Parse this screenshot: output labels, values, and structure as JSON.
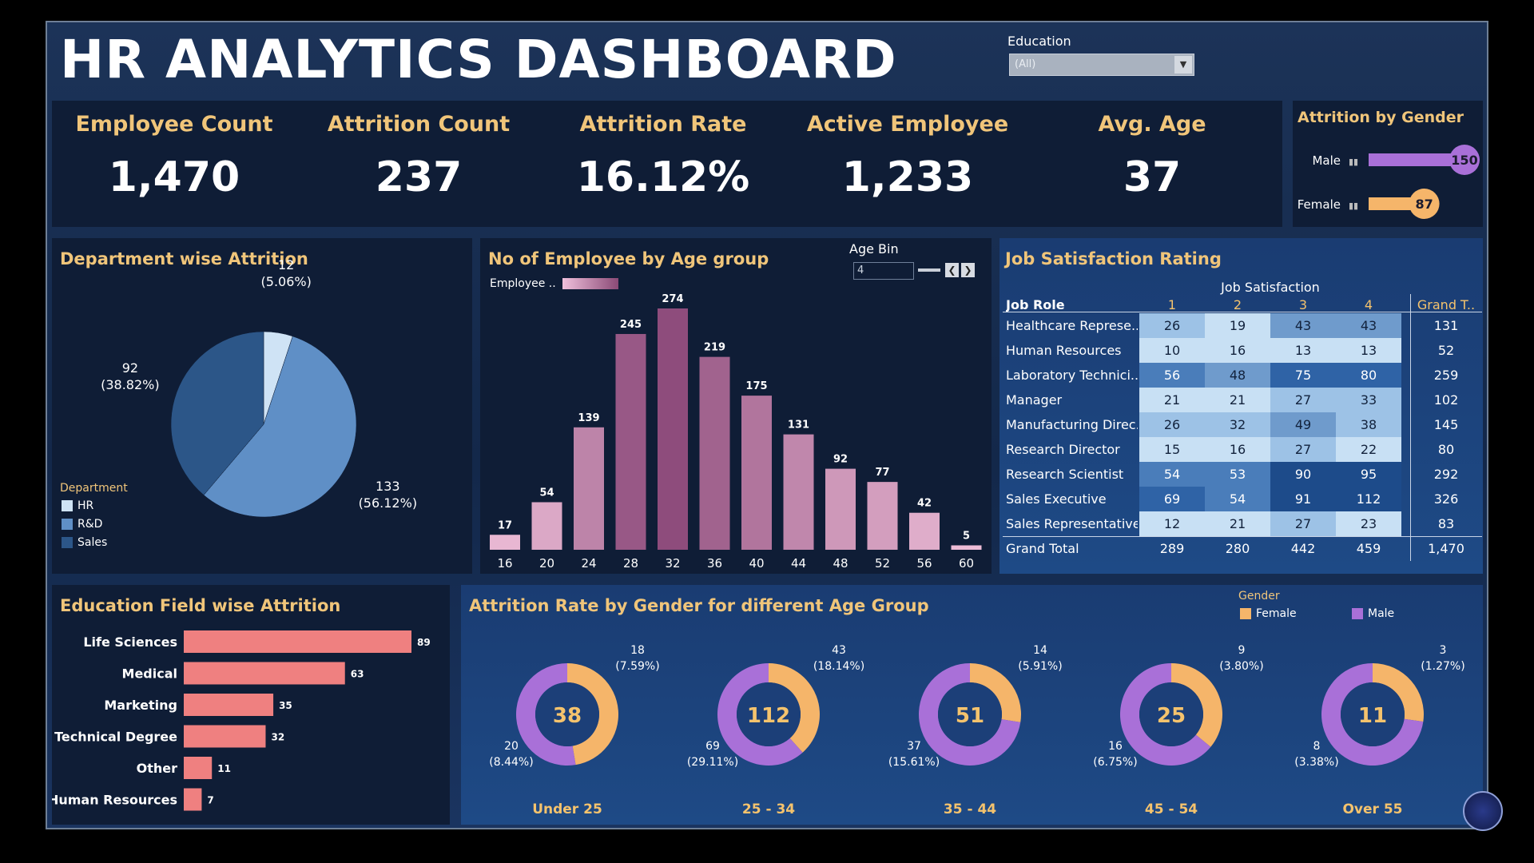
{
  "title": "HR ANALYTICS DASHBOARD",
  "filter": {
    "label": "Education",
    "value": "(All)"
  },
  "kpis": [
    {
      "label": "Employee Count",
      "value": "1,470"
    },
    {
      "label": "Attrition Count",
      "value": "237"
    },
    {
      "label": "Attrition Rate",
      "value": "16.12%"
    },
    {
      "label": "Active Employee",
      "value": "1,233"
    },
    {
      "label": "Avg. Age",
      "value": "37"
    }
  ],
  "gender": {
    "title": "Attrition by Gender",
    "rows": [
      {
        "label": "Male",
        "value": 150,
        "text": "150",
        "color": "#a970d8"
      },
      {
        "label": "Female",
        "value": 87,
        "text": "87",
        "color": "#f5b56a"
      }
    ]
  },
  "dept": {
    "title": "Department wise Attrition",
    "legend_title": "Department",
    "slices": [
      {
        "name": "HR",
        "value": 12,
        "label1": "12",
        "label2": "(5.06%)",
        "color": "#cfe3f5"
      },
      {
        "name": "R&D",
        "value": 133,
        "label1": "133",
        "label2": "(56.12%)",
        "color": "#5f8fc6"
      },
      {
        "name": "Sales",
        "value": 92,
        "label1": "92",
        "label2": "(38.82%)",
        "color": "#2c5688"
      }
    ]
  },
  "age": {
    "title": "No of Employee by Age group",
    "legend_label": "Employee ..",
    "bin_label": "Age Bin",
    "bin_value": "4",
    "bars": [
      {
        "x": "16",
        "v": 17
      },
      {
        "x": "20",
        "v": 54
      },
      {
        "x": "24",
        "v": 139
      },
      {
        "x": "28",
        "v": 245
      },
      {
        "x": "32",
        "v": 274
      },
      {
        "x": "36",
        "v": 219
      },
      {
        "x": "40",
        "v": 175
      },
      {
        "x": "44",
        "v": 131
      },
      {
        "x": "48",
        "v": 92
      },
      {
        "x": "52",
        "v": 77
      },
      {
        "x": "56",
        "v": 42
      },
      {
        "x": "60",
        "v": 5
      }
    ]
  },
  "jobsat": {
    "title": "Job Satisfaction Rating",
    "col_group": "Job Satisfaction",
    "row_header": "Job Role",
    "cols": [
      "1",
      "2",
      "3",
      "4"
    ],
    "grand_header": "Grand T..",
    "rows": [
      {
        "role": "Healthcare Represe..",
        "vals": [
          26,
          19,
          43,
          43
        ],
        "total": "131"
      },
      {
        "role": "Human Resources",
        "vals": [
          10,
          16,
          13,
          13
        ],
        "total": "52"
      },
      {
        "role": "Laboratory Technici..",
        "vals": [
          56,
          48,
          75,
          80
        ],
        "total": "259"
      },
      {
        "role": "Manager",
        "vals": [
          21,
          21,
          27,
          33
        ],
        "total": "102"
      },
      {
        "role": "Manufacturing Direc..",
        "vals": [
          26,
          32,
          49,
          38
        ],
        "total": "145"
      },
      {
        "role": "Research Director",
        "vals": [
          15,
          16,
          27,
          22
        ],
        "total": "80"
      },
      {
        "role": "Research Scientist",
        "vals": [
          54,
          53,
          90,
          95
        ],
        "total": "292"
      },
      {
        "role": "Sales Executive",
        "vals": [
          69,
          54,
          91,
          112
        ],
        "total": "326"
      },
      {
        "role": "Sales Representative",
        "vals": [
          12,
          21,
          27,
          23
        ],
        "total": "83"
      }
    ],
    "grand_label": "Grand Total",
    "grand_vals": [
      "289",
      "280",
      "442",
      "459"
    ],
    "grand_total": "1,470"
  },
  "edu": {
    "title": "Education Field wise Attrition",
    "bars": [
      {
        "name": "Life Sciences",
        "v": 89
      },
      {
        "name": "Medical",
        "v": 63
      },
      {
        "name": "Marketing",
        "v": 35
      },
      {
        "name": "Technical Degree",
        "v": 32
      },
      {
        "name": "Other",
        "v": 11
      },
      {
        "name": "Human Resources",
        "v": 7
      }
    ],
    "color": "#ef8080"
  },
  "donuts": {
    "title": "Attrition Rate by Gender for different Age Group",
    "legend_title": "Gender",
    "legend": [
      {
        "name": "Female",
        "color": "#f5b56a"
      },
      {
        "name": "Male",
        "color": "#a970d8"
      }
    ],
    "groups": [
      {
        "label": "Under 25",
        "total": "38",
        "female": 18,
        "male": 20,
        "f1": "18",
        "f2": "(7.59%)",
        "m1": "20",
        "m2": "(8.44%)"
      },
      {
        "label": "25 - 34",
        "total": "112",
        "female": 43,
        "male": 69,
        "f1": "43",
        "f2": "(18.14%)",
        "m1": "69",
        "m2": "(29.11%)"
      },
      {
        "label": "35 - 44",
        "total": "51",
        "female": 14,
        "male": 37,
        "f1": "14",
        "f2": "(5.91%)",
        "m1": "37",
        "m2": "(15.61%)"
      },
      {
        "label": "45 - 54",
        "total": "25",
        "female": 9,
        "male": 16,
        "f1": "9",
        "f2": "(3.80%)",
        "m1": "16",
        "m2": "(6.75%)"
      },
      {
        "label": "Over 55",
        "total": "11",
        "female": 3,
        "male": 8,
        "f1": "3",
        "f2": "(1.27%)",
        "m1": "8",
        "m2": "(3.38%)"
      }
    ]
  },
  "chart_data": [
    {
      "type": "bar",
      "title": "Attrition by Gender",
      "categories": [
        "Male",
        "Female"
      ],
      "values": [
        150,
        87
      ]
    },
    {
      "type": "pie",
      "title": "Department wise Attrition",
      "categories": [
        "HR",
        "R&D",
        "Sales"
      ],
      "values": [
        12,
        133,
        92
      ]
    },
    {
      "type": "bar",
      "title": "No of Employee by Age group",
      "categories": [
        "16",
        "20",
        "24",
        "28",
        "32",
        "36",
        "40",
        "44",
        "48",
        "52",
        "56",
        "60"
      ],
      "values": [
        17,
        54,
        139,
        245,
        274,
        219,
        175,
        131,
        92,
        77,
        42,
        5
      ]
    },
    {
      "type": "table",
      "title": "Job Satisfaction Rating",
      "columns": [
        "1",
        "2",
        "3",
        "4"
      ],
      "rows": [
        "Healthcare Represe..",
        "Human Resources",
        "Laboratory Technici..",
        "Manager",
        "Manufacturing Direc..",
        "Research Director",
        "Research Scientist",
        "Sales Executive",
        "Sales Representative"
      ],
      "values": [
        [
          26,
          19,
          43,
          43
        ],
        [
          10,
          16,
          13,
          13
        ],
        [
          56,
          48,
          75,
          80
        ],
        [
          21,
          21,
          27,
          33
        ],
        [
          26,
          32,
          49,
          38
        ],
        [
          15,
          16,
          27,
          22
        ],
        [
          54,
          53,
          90,
          95
        ],
        [
          69,
          54,
          91,
          112
        ],
        [
          12,
          21,
          27,
          23
        ]
      ]
    },
    {
      "type": "bar",
      "title": "Education Field wise Attrition",
      "categories": [
        "Life Sciences",
        "Medical",
        "Marketing",
        "Technical Degree",
        "Other",
        "Human Resources"
      ],
      "values": [
        89,
        63,
        35,
        32,
        11,
        7
      ]
    },
    {
      "type": "pie",
      "title": "Attrition Rate by Gender for different Age Group",
      "categories": [
        "Under 25",
        "25 - 34",
        "35 - 44",
        "45 - 54",
        "Over 55"
      ],
      "series": [
        {
          "name": "Female",
          "values": [
            18,
            43,
            14,
            9,
            3
          ]
        },
        {
          "name": "Male",
          "values": [
            20,
            69,
            37,
            16,
            8
          ]
        }
      ]
    }
  ]
}
